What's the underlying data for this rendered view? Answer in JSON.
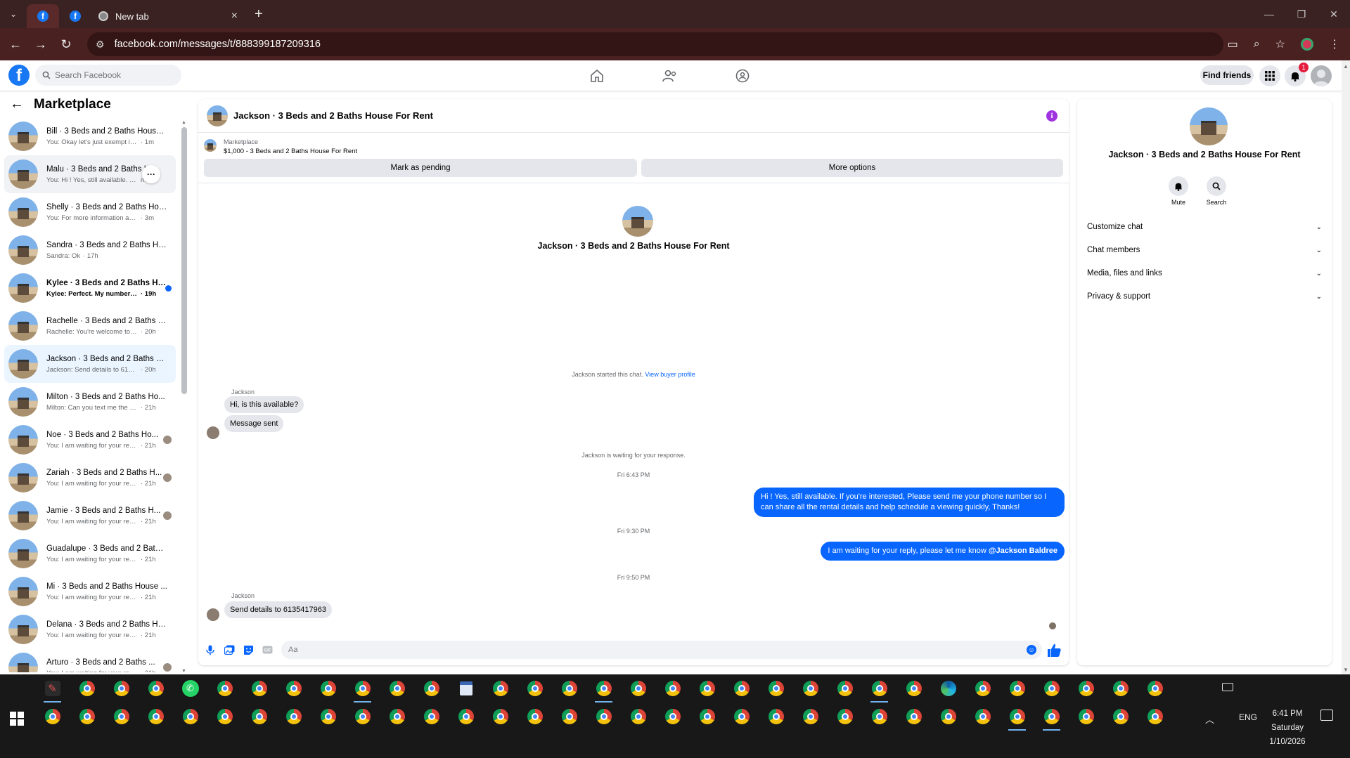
{
  "browser": {
    "tabs": [
      {
        "title": "",
        "icon": "facebook-icon"
      },
      {
        "title": "",
        "icon": "facebook-icon"
      },
      {
        "title": "New tab",
        "icon": "chrome-icon"
      }
    ],
    "url": "facebook.com/messages/t/888399187209316"
  },
  "fb_header": {
    "search_placeholder": "Search Facebook",
    "find_friends_label": "Find friends",
    "notification_count": "1",
    "brand_color": "#1877f2"
  },
  "marketplace": {
    "title": "Marketplace",
    "conversations": [
      {
        "name": "Bill · 3 Beds and 2 Baths House ...",
        "preview": "You: Okay let's just exempt it. I ca...",
        "time": "· 1m",
        "state": "read"
      },
      {
        "name": "Malu · 3 Beds and 2 Baths H...",
        "preview": "You: Hi ! Yes, still available. If you...",
        "time": "m",
        "state": "hover"
      },
      {
        "name": "Shelly · 3 Beds and 2 Baths Hou...",
        "preview": "You: For more information and re...",
        "time": "· 3m",
        "state": "read"
      },
      {
        "name": "Sandra · 3 Beds and 2 Baths Ho...",
        "preview": "Sandra: Ok",
        "time": "· 17h",
        "state": "read"
      },
      {
        "name": "Kylee · 3 Beds and 2 Baths Ho...",
        "preview": "Kylee: Perfect. My number is (...",
        "time": "· 19h",
        "state": "unread"
      },
      {
        "name": "Rachelle · 3 Beds and 2 Baths H...",
        "preview": "Rachelle: You're welcome to send...",
        "time": "· 20h",
        "state": "read"
      },
      {
        "name": "Jackson · 3 Beds and 2 Baths H...",
        "preview": "Jackson: Send details to 6135417...",
        "time": "· 20h",
        "state": "selected"
      },
      {
        "name": "Milton · 3 Beds and 2 Baths Ho...",
        "preview": "Milton: Can you text me the deta...",
        "time": "· 21h",
        "state": "read"
      },
      {
        "name": "Noe · 3 Beds and 2 Baths Ho...",
        "preview": "You: I am waiting for your repl...",
        "time": "· 21h",
        "state": "seen"
      },
      {
        "name": "Zariah · 3 Beds and 2 Baths H...",
        "preview": "You: I am waiting for your repl...",
        "time": "· 21h",
        "state": "seen"
      },
      {
        "name": "Jamie · 3 Beds and 2 Baths H...",
        "preview": "You: I am waiting for your repl...",
        "time": "· 21h",
        "state": "seen"
      },
      {
        "name": "Guadalupe · 3 Beds and 2 Baths...",
        "preview": "You: I am waiting for your reply, ...",
        "time": "· 21h",
        "state": "read"
      },
      {
        "name": "Mi · 3 Beds and 2 Baths House ...",
        "preview": "You: I am waiting for your reply, ...",
        "time": "· 21h",
        "state": "read"
      },
      {
        "name": "Delana · 3 Beds and 2 Baths Ho...",
        "preview": "You: I am waiting for your reply, ...",
        "time": "· 21h",
        "state": "read"
      },
      {
        "name": "Arturo · 3 Beds and 2 Baths ...",
        "preview": "You: I am waiting for your reply...",
        "time": "· 21h",
        "state": "seen"
      }
    ]
  },
  "chat": {
    "title": "Jackson · 3 Beds and 2 Baths House For Rent",
    "listing_source": "Marketplace",
    "listing": "$1,000 - 3 Beds and 2 Baths House For Rent",
    "mark_pending_label": "Mark as pending",
    "more_options_label": "More options",
    "intro_name": "Jackson · 3 Beds and 2 Baths House For Rent",
    "started_text": "Jackson started this chat.",
    "view_profile_link": "View buyer profile",
    "sender_name": "Jackson",
    "msg1": "Hi, is this available?",
    "msg2": "Message sent",
    "waiting_text": "Jackson is waiting for your response.",
    "time1": "Fri 6:43 PM",
    "out1": "Hi ! Yes, still available. If you're interested, Please send me your phone number so I can share all the rental details and help schedule a viewing quickly, Thanks!",
    "time2": "Fri 9:30 PM",
    "out2_text": "I am waiting for your reply, please let me know ",
    "out2_mention": "@Jackson Baldree",
    "time3": "Fri 9:50 PM",
    "sender_name2": "Jackson",
    "msg3": "Send details to 6135417963",
    "composer_placeholder": "Aa",
    "outgoing_color": "#0866ff"
  },
  "info_panel": {
    "name": "Jackson · 3 Beds and 2 Baths House For Rent",
    "mute_label": "Mute",
    "search_label": "Search",
    "sections": [
      "Customize chat",
      "Chat members",
      "Media, files and links",
      "Privacy & support"
    ]
  },
  "taskbar": {
    "lang": "ENG",
    "time": "6:41 PM",
    "day": "Saturday",
    "date": "1/10/2026"
  }
}
